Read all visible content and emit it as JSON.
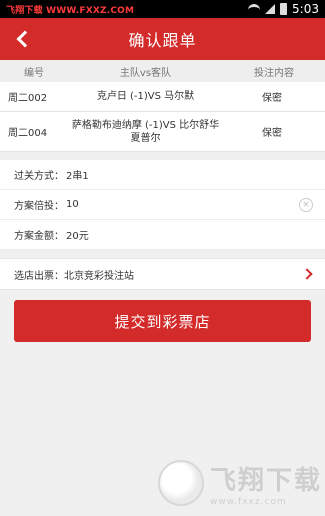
{
  "statusbar": {
    "source_label": "飞翔下载 WWW.FXXZ.COM",
    "time": "5:03"
  },
  "header": {
    "title": "确认跟单"
  },
  "table": {
    "headers": [
      "编号",
      "主队vs客队",
      "投注内容"
    ],
    "rows": [
      {
        "id": "周二002",
        "match": "克卢日 (-1)VS 马尔默",
        "bet": "保密"
      },
      {
        "id": "周二004",
        "match": "萨格勒布迪纳摩 (-1)VS 比尔舒华夏普尔",
        "bet": "保密"
      }
    ]
  },
  "form": {
    "pass_label": "过关方式：",
    "pass_value": "2串1",
    "multiple_label": "方案倍投：",
    "multiple_value": "10",
    "amount_label": "方案金额：",
    "amount_value": "20元"
  },
  "store": {
    "label": "选店出票：",
    "value": "北京竞彩投注站"
  },
  "submit_label": "提交到彩票店",
  "watermark": {
    "cn": "飞翔下载",
    "url": "www.fxxz.com"
  }
}
